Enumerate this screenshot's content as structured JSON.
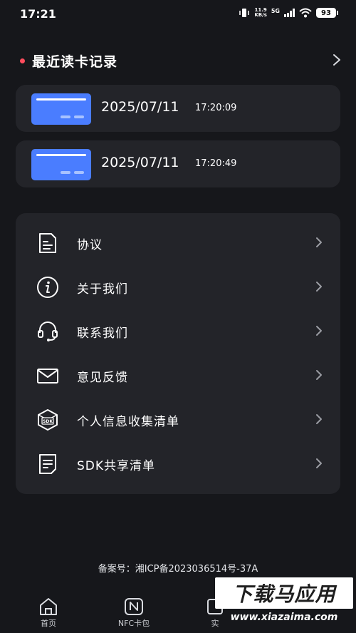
{
  "status_bar": {
    "time": "17:21",
    "net_speed_value": "11.9",
    "net_speed_unit": "KB/s",
    "net_type": "5G",
    "battery": "93"
  },
  "recent": {
    "title": "最近读卡记录",
    "records": [
      {
        "date": "2025/07/11",
        "time": "17:20:09"
      },
      {
        "date": "2025/07/11",
        "time": "17:20:49"
      }
    ]
  },
  "menu": {
    "items": [
      {
        "label": "协议",
        "icon": "document-icon"
      },
      {
        "label": "关于我们",
        "icon": "info-icon"
      },
      {
        "label": "联系我们",
        "icon": "headset-icon"
      },
      {
        "label": "意见反馈",
        "icon": "mail-icon"
      },
      {
        "label": "个人信息收集清单",
        "icon": "sdk-box-icon"
      },
      {
        "label": "SDK共享清单",
        "icon": "checklist-icon"
      }
    ]
  },
  "icp": "备案号：湘ICP备2023036514号-37A",
  "tabs": [
    {
      "label": "首页",
      "icon": "home-icon"
    },
    {
      "label": "NFC卡包",
      "icon": "nfc-icon"
    },
    {
      "label": "实",
      "icon": "tool-icon"
    }
  ],
  "watermark": {
    "title": "下载马应用",
    "url": "www.xiazaima.com"
  },
  "colors": {
    "background": "#16171b",
    "card": "#232429",
    "accent_blue": "#4a7dff",
    "dot_red": "#ff4d5e"
  }
}
